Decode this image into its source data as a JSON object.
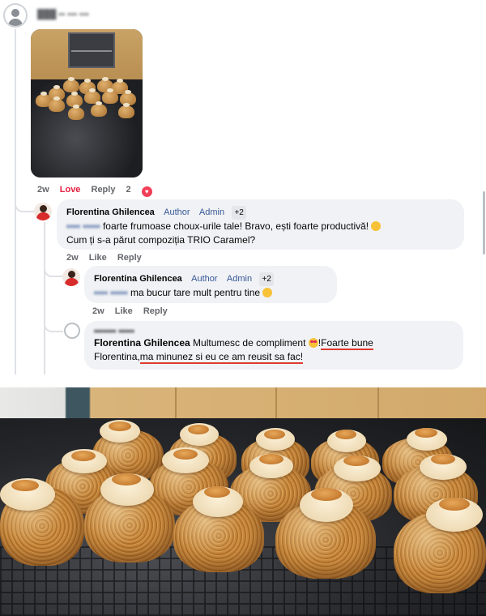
{
  "thread": {
    "comments": [
      {
        "time": "2w",
        "love_label": "Love",
        "reply_label": "Reply",
        "reaction_count": "2"
      },
      {
        "author": "Florentina Ghilencea",
        "badge_author": "Author",
        "badge_admin": "Admin",
        "badge_plus": "+2",
        "text_line1": "foarte frumoase choux-urile tale! Bravo, ești foarte productivă!",
        "text_line2": "Cum ți s-a părut compoziția TRIO Caramel?",
        "time": "2w",
        "like_label": "Like",
        "reply_label": "Reply"
      },
      {
        "author": "Florentina Ghilencea",
        "badge_author": "Author",
        "badge_admin": "Admin",
        "badge_plus": "+2",
        "text": "ma bucur tare mult pentru tine",
        "time": "2w",
        "like_label": "Like",
        "reply_label": "Reply"
      },
      {
        "author": "Florentina Ghilencea",
        "text_a": "Multumesc de compliment",
        "text_b": "!",
        "text_u1": "Foarte bune",
        "text_line2_a": "Florentina,",
        "text_u2": "ma minunez si eu ce am reusit sa fac!"
      }
    ]
  },
  "icons": [
    "user-avatar-icon",
    "reaction-heart-icon",
    "grin-emoji-icon",
    "heart-eyes-emoji-icon"
  ],
  "colors": {
    "link": "#385898",
    "love": "#e41e3f",
    "underline": "#e03a2f",
    "bubble": "#f0f2f5"
  }
}
